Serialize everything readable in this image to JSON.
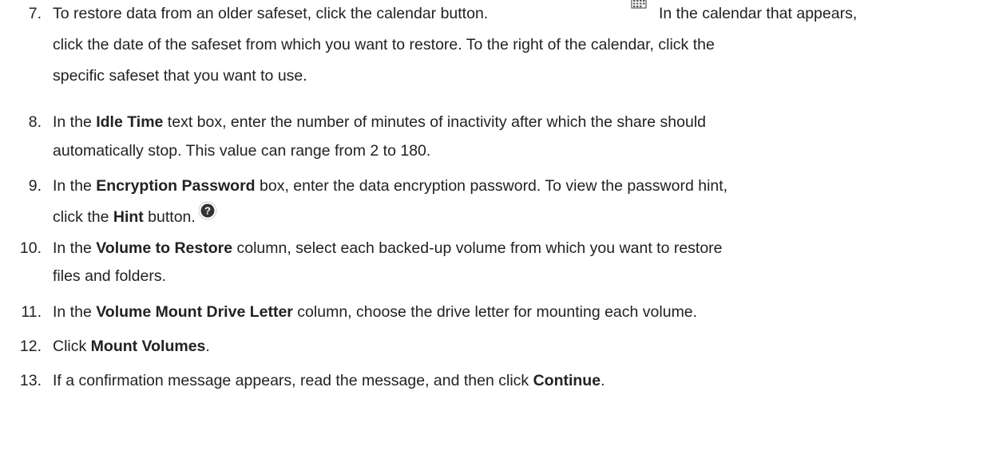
{
  "steps": [
    {
      "number": "7.",
      "lines": [
        {
          "before": "To restore data from an older safeset, click the calendar button.",
          "after": "In the calendar that appears,"
        },
        {
          "text": "click the date of the safeset from which you want to restore. To the right of the calendar, click the"
        },
        {
          "text": "specific safeset that you want to use."
        }
      ],
      "icon": "calendar-icon"
    },
    {
      "number": "8.",
      "lines": [
        {
          "pre": "In the ",
          "bold": "Idle Time",
          "post": " text box, enter the number of minutes of inactivity after which the share should"
        },
        {
          "text": "automatically stop. This value can range from 2 to 180."
        }
      ]
    },
    {
      "number": "9.",
      "lines": [
        {
          "pre": "In the ",
          "bold": "Encryption Password",
          "post": " box, enter the data encryption password. To view the password hint,"
        },
        {
          "pre": "click the ",
          "bold": "Hint",
          "post": " button."
        }
      ],
      "icon": "question-circle-icon"
    },
    {
      "number": "10.",
      "lines": [
        {
          "pre": "In the ",
          "bold": "Volume to Restore",
          "post": " column, select each backed-up volume from which you want to restore"
        },
        {
          "text": "files and folders."
        }
      ]
    },
    {
      "number": "11.",
      "lines": [
        {
          "pre": "In the ",
          "bold": "Volume Mount Drive Letter",
          "post": " column, choose the drive letter for mounting each volume."
        }
      ]
    },
    {
      "number": "12.",
      "lines": [
        {
          "pre": "Click ",
          "bold": "Mount Volumes",
          "post": "."
        }
      ]
    },
    {
      "number": "13.",
      "lines": [
        {
          "pre": "If a confirmation message appears, read the message, and then click ",
          "bold": "Continue",
          "post": "."
        }
      ]
    }
  ]
}
